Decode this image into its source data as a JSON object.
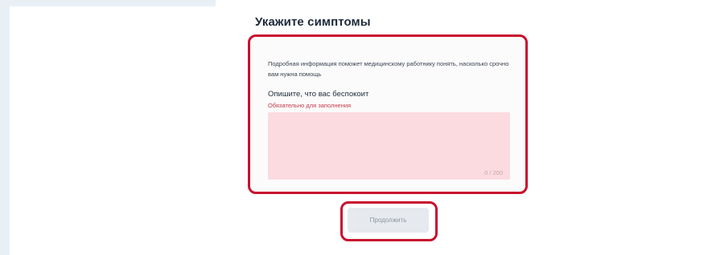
{
  "form": {
    "title": "Укажите симптомы",
    "hint": "Подробная информация поможет медицинскому работнику понять, насколько срочно вам нужна помощь",
    "field_label": "Опишите, что вас беспокоит",
    "required_note": "Обязательно для заполнения",
    "textarea_value": "",
    "counter": "0 / 200"
  },
  "actions": {
    "continue_label": "Продолжить"
  },
  "colors": {
    "highlight_border": "#c8102e",
    "textarea_error_bg": "#fbdbe0",
    "required_text": "#c63a4c",
    "button_disabled_bg": "#e6e9ee"
  }
}
